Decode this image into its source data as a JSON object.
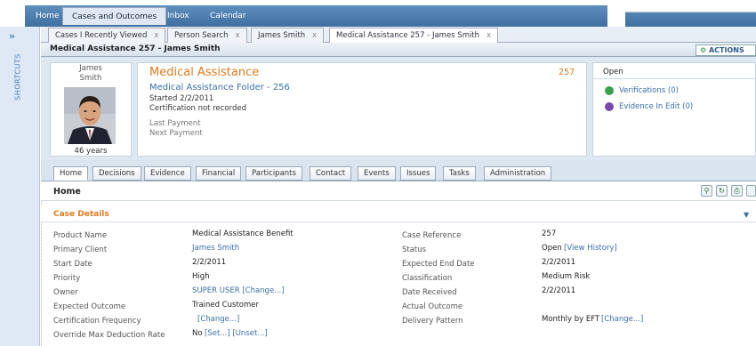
{
  "top_nav": {
    "tabs": [
      "Home",
      "Cases and Outcomes",
      "Inbox",
      "Calendar"
    ],
    "active": "Cases and Outcomes"
  },
  "shortcuts": {
    "label": "SHORTCUTS",
    "toggle_glyph": "»"
  },
  "window_tabs": [
    {
      "label": "Cases I Recently Viewed"
    },
    {
      "label": "Person Search"
    },
    {
      "label": "James Smith"
    },
    {
      "label": "Medical Assistance 257 - James Smith"
    }
  ],
  "close_glyph": "x",
  "page": {
    "title": "Medical Assistance 257 - James Smith",
    "actions_label": "ACTIONS"
  },
  "person": {
    "first_name": "James",
    "last_name": "Smith",
    "age": "46 years"
  },
  "case_summary": {
    "title": "Medical Assistance",
    "number": "257",
    "folder": "Medical Assistance Folder - 256",
    "started": "Started 2/2/2011",
    "certification": "Certification not recorded",
    "last_payment": "Last Payment",
    "next_payment": "Next Payment"
  },
  "status_panel": {
    "status": "Open",
    "verifications": "Verifications (0)",
    "evidence": "Evidence In Edit (0)"
  },
  "page_tabs": [
    "Home",
    "Decisions",
    "Evidence",
    "Financial",
    "Participants",
    "Contact",
    "Events",
    "Issues",
    "Tasks",
    "Administration"
  ],
  "active_page_tab": "Home",
  "home": {
    "title": "Home",
    "section_title": "Case Details"
  },
  "left_fields": [
    {
      "label": "Product Name",
      "value": "Medical Assistance Benefit",
      "link": ""
    },
    {
      "label": "Primary Client",
      "value": "",
      "link": "James Smith"
    },
    {
      "label": "Start Date",
      "value": "2/2/2011",
      "link": ""
    },
    {
      "label": "Priority",
      "value": "High",
      "link": ""
    },
    {
      "label": "Owner",
      "value": "",
      "link": "SUPER USER [Change...]"
    },
    {
      "label": "Expected Outcome",
      "value": "Trained Customer",
      "link": ""
    },
    {
      "label": "Certification Frequency",
      "value": "",
      "link": "[Change...]"
    },
    {
      "label": "Override Max Deduction Rate",
      "value": "No",
      "link": "[Set...] [Unset...]"
    }
  ],
  "right_fields": [
    {
      "label": "Case Reference",
      "value": "257",
      "link": ""
    },
    {
      "label": "Status",
      "value": "Open",
      "link": "[View History]"
    },
    {
      "label": "Expected End Date",
      "value": "2/2/2011",
      "link": ""
    },
    {
      "label": "Classification",
      "value": "Medium Risk",
      "link": ""
    },
    {
      "label": "Date Received",
      "value": "2/2/2011",
      "link": ""
    },
    {
      "label": "Actual Outcome",
      "value": "",
      "link": ""
    },
    {
      "label": "Delivery Pattern",
      "value": "Monthly by EFT",
      "link": "[Change...]"
    }
  ],
  "colors": {
    "accent_orange": "#e07a1f",
    "link_blue": "#3a6ea8",
    "header_blue": "#4a7fb5"
  }
}
